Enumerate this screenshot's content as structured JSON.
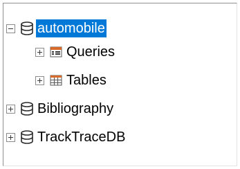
{
  "tree": {
    "items": [
      {
        "label": "automobile",
        "expanded": true,
        "selected": true,
        "icon": "database-icon"
      },
      {
        "label": "Queries",
        "expanded": false,
        "selected": false,
        "icon": "queries-icon"
      },
      {
        "label": "Tables",
        "expanded": false,
        "selected": false,
        "icon": "table-icon"
      },
      {
        "label": "Bibliography",
        "expanded": false,
        "selected": false,
        "icon": "database-icon"
      },
      {
        "label": "TrackTraceDB",
        "expanded": false,
        "selected": false,
        "icon": "database-icon"
      }
    ]
  },
  "colors": {
    "selection": "#0078d7",
    "selection_text": "#ffffff",
    "queries_icon_header": "#d86b2a",
    "tables_icon_header": "#d86b2a"
  }
}
